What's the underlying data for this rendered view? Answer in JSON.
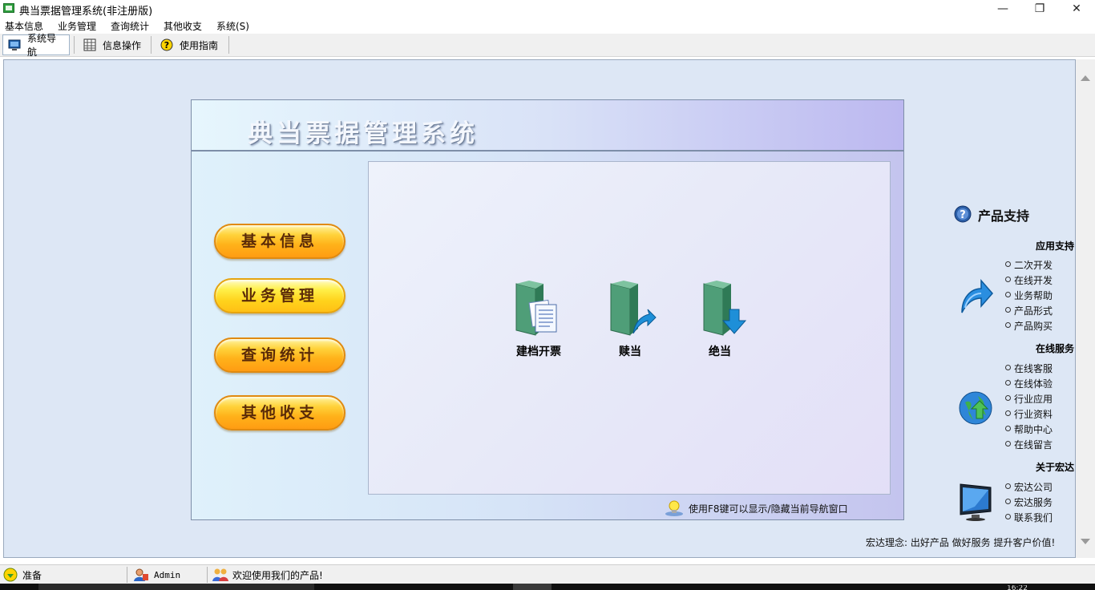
{
  "window": {
    "title": "典当票据管理系统(非注册版)",
    "min_glyph": "—",
    "max_glyph": "❐",
    "close_glyph": "✕"
  },
  "menu": [
    "基本信息",
    "业务管理",
    "查询统计",
    "其他收支",
    "系统(S)"
  ],
  "toolbar": {
    "buttons": [
      {
        "label": "系统导航",
        "icon": "monitor-icon",
        "active": true
      },
      {
        "label": "信息操作",
        "icon": "grid-icon",
        "active": false
      },
      {
        "label": "使用指南",
        "icon": "help-icon",
        "active": false
      }
    ]
  },
  "nav": {
    "title": "典当票据管理系统",
    "buttons": [
      "基本信息",
      "业务管理",
      "查询统计",
      "其他收支"
    ],
    "actions": [
      {
        "label": "建档开票",
        "icon": "folder-document-icon"
      },
      {
        "label": "赎当",
        "icon": "folder-arrow-icon"
      },
      {
        "label": "绝当",
        "icon": "folder-down-arrow-icon"
      }
    ],
    "hint": "使用F8键可以显示/隐藏当前导航窗口"
  },
  "sidebar": {
    "title": "产品支持",
    "groups": [
      {
        "heading": "应用支持",
        "icon": "curved-arrow-icon",
        "links": [
          "二次开发",
          "在线开发",
          "业务帮助",
          "产品形式",
          "产品购买"
        ]
      },
      {
        "heading": "在线服务",
        "icon": "globe-icon",
        "links": [
          "在线客服",
          "在线体验",
          "行业应用",
          "行业资料",
          "帮助中心",
          "在线留言"
        ]
      },
      {
        "heading": "关于宏达",
        "icon": "computer-monitor-icon",
        "links": [
          "宏达公司",
          "宏达服务",
          "联系我们"
        ]
      }
    ],
    "slogan": "宏达理念: 出好产品  做好服务  提升客户价值!"
  },
  "status": {
    "state": "准备",
    "user": "Admin",
    "welcome": "欢迎使用我们的产品!"
  },
  "taskbar": {
    "clock": "16:22"
  },
  "colors": {
    "main_bg": "#dde7f5",
    "pill_orange": "#ff9c12",
    "pill_yellow": "#ffd31c",
    "panel_border": "#7d8ea8"
  }
}
